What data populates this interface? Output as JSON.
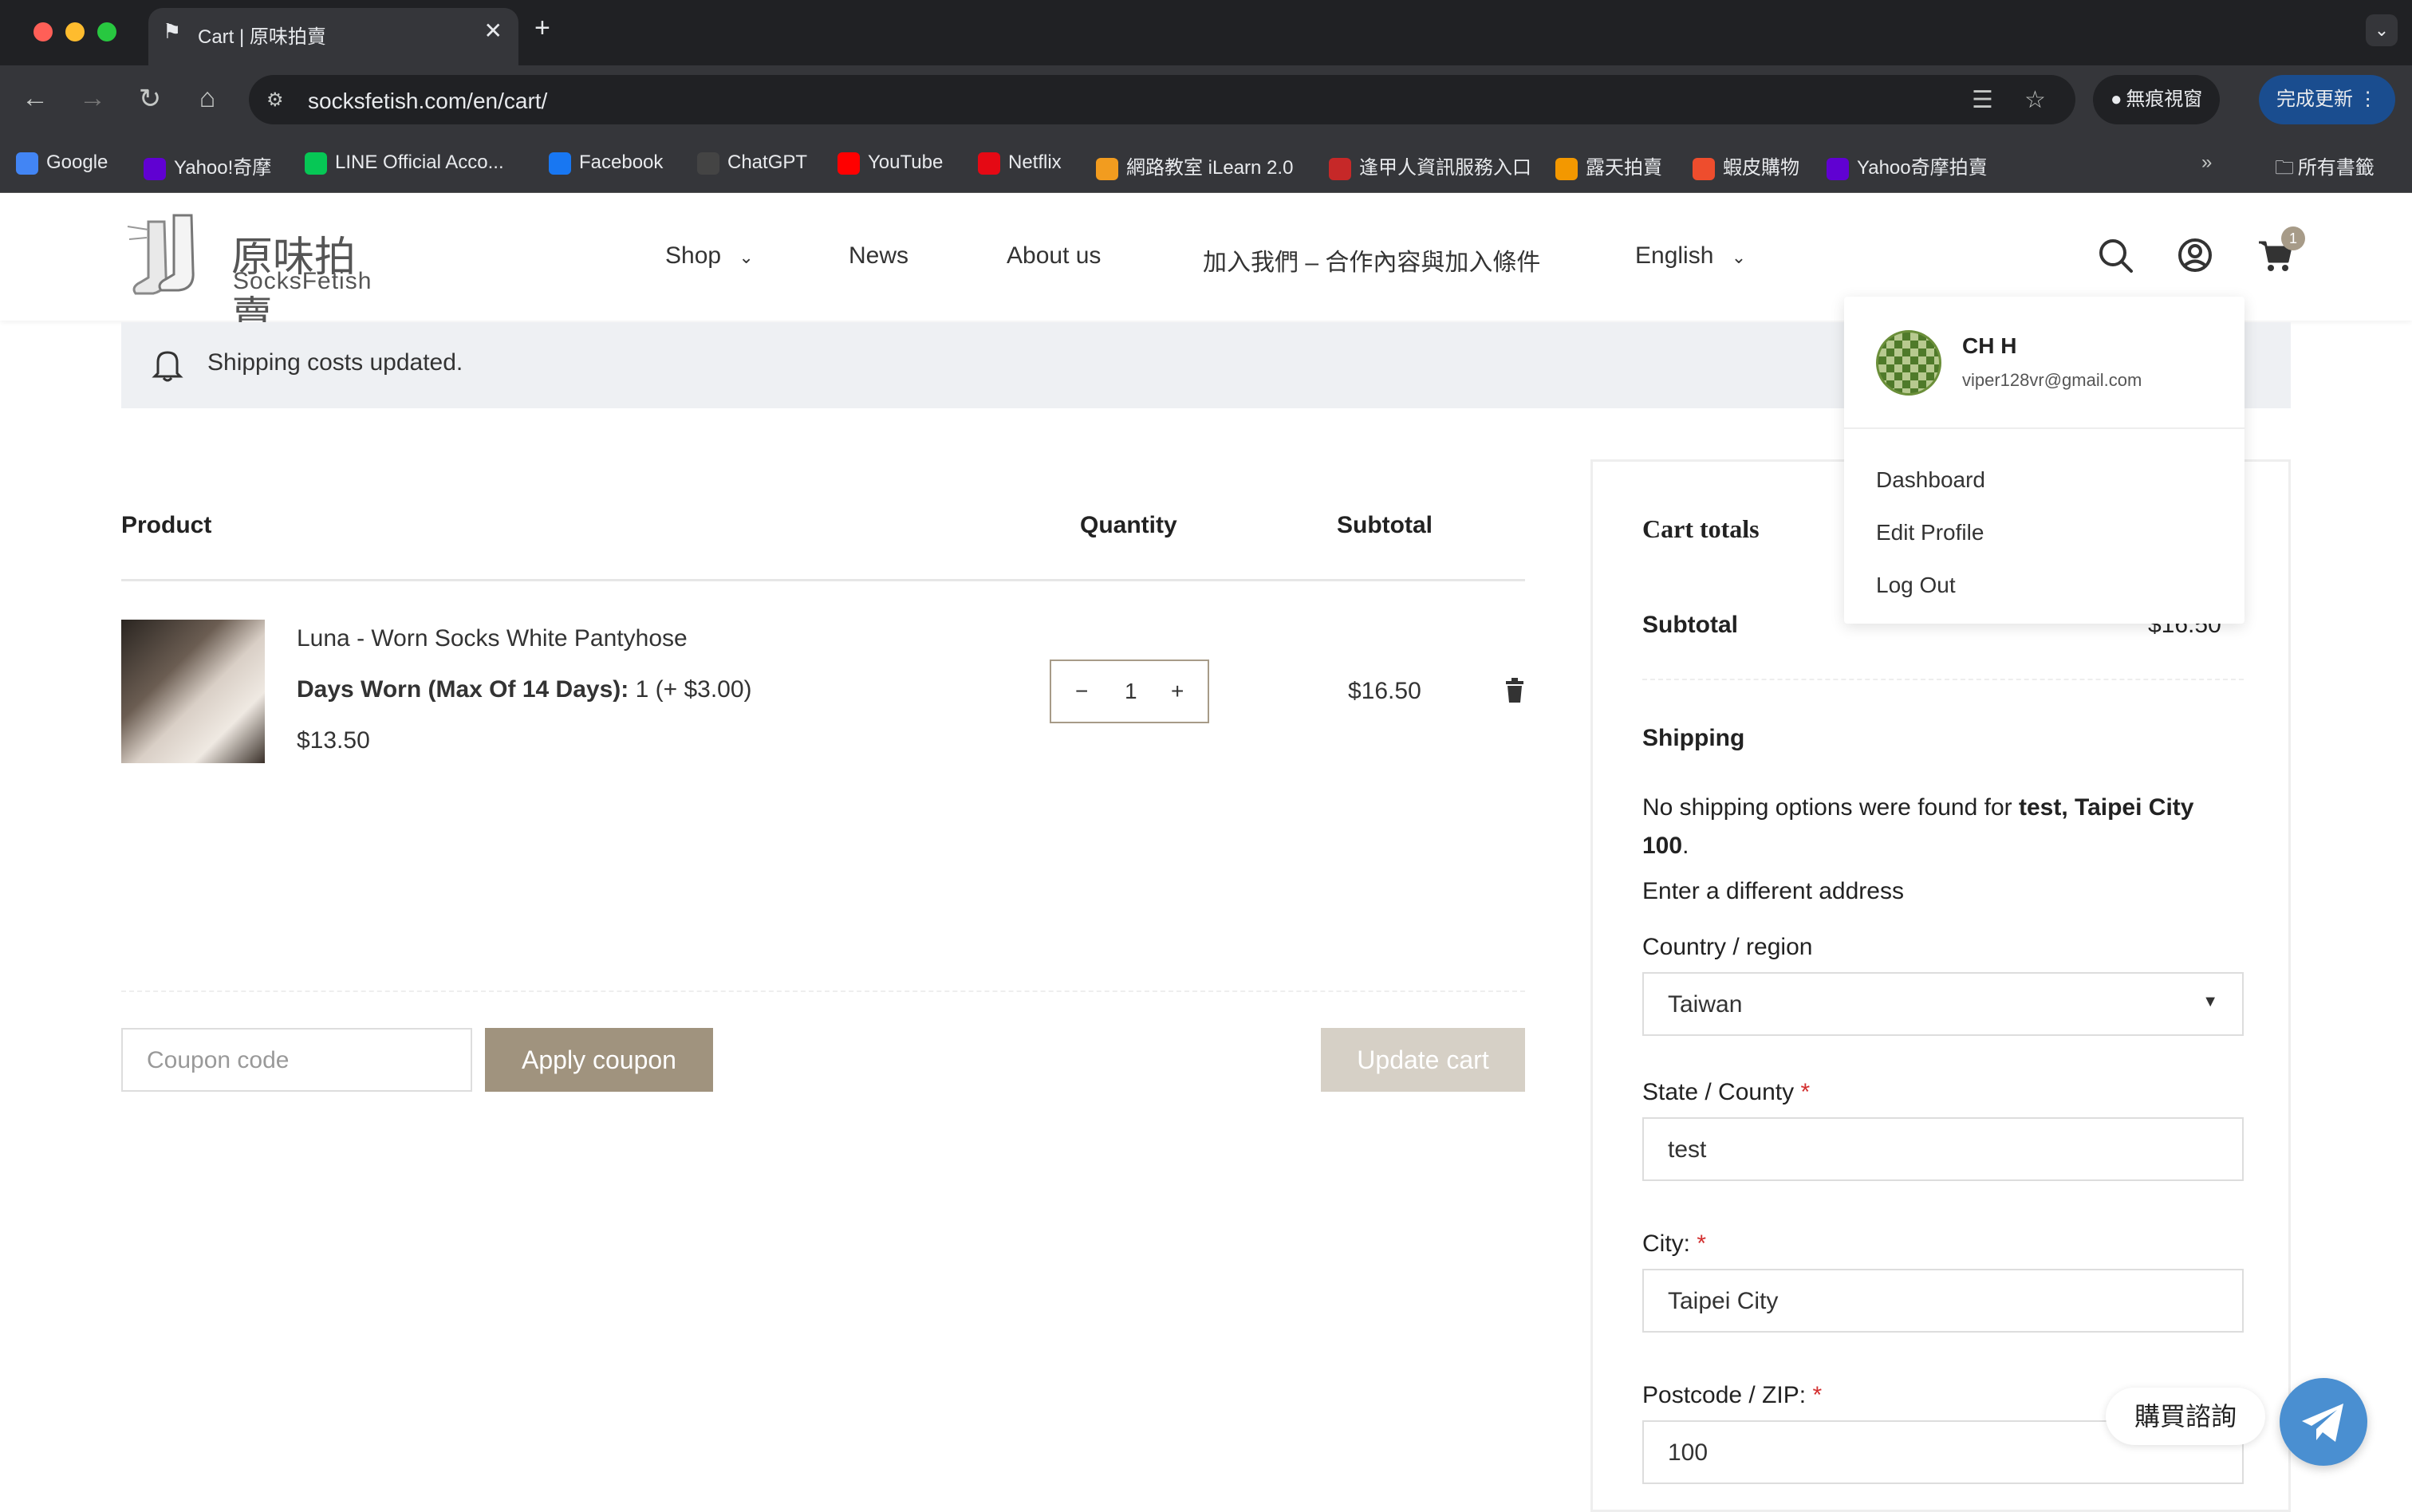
{
  "browser": {
    "tab_title": "Cart | 原味拍賣",
    "url": "socksfetish.com/en/cart/",
    "incognito_label": "無痕視窗",
    "update_label": "完成更新",
    "bookmarks": [
      {
        "label": "Google",
        "icon": "google-icon",
        "color": "#4285f4"
      },
      {
        "label": "Yahoo!奇摩",
        "icon": "yahoo-icon",
        "color": "#6001d2"
      },
      {
        "label": "LINE Official Acco...",
        "icon": "line-icon",
        "color": "#06c755"
      },
      {
        "label": "Facebook",
        "icon": "facebook-icon",
        "color": "#1877f2"
      },
      {
        "label": "ChatGPT",
        "icon": "chatgpt-icon",
        "color": "#444"
      },
      {
        "label": "YouTube",
        "icon": "youtube-icon",
        "color": "#ff0000"
      },
      {
        "label": "Netflix",
        "icon": "netflix-icon",
        "color": "#e50914"
      },
      {
        "label": "網路教室 iLearn 2.0",
        "icon": "ilearn-icon",
        "color": "#f29c1f"
      },
      {
        "label": "逢甲人資訊服務入口",
        "icon": "fcu-icon",
        "color": "#c62828"
      },
      {
        "label": "露天拍賣",
        "icon": "ruten-icon",
        "color": "#f39800"
      },
      {
        "label": "蝦皮購物",
        "icon": "shopee-icon",
        "color": "#ee4d2d"
      },
      {
        "label": "Yahoo奇摩拍賣",
        "icon": "yahoo-auction-icon",
        "color": "#6001d2"
      }
    ],
    "all_bookmarks_label": "所有書籤"
  },
  "site": {
    "logo_cn": "原味拍賣",
    "logo_en": "SocksFetish",
    "menu": {
      "shop": "Shop",
      "news": "News",
      "about": "About us",
      "join": "加入我們 – 合作內容與加入條件",
      "language": "English"
    },
    "cart_count": "1"
  },
  "notice": "Shipping costs updated.",
  "cart": {
    "headers": {
      "product": "Product",
      "quantity": "Quantity",
      "subtotal": "Subtotal"
    },
    "item": {
      "name": "Luna - Worn Socks White Pantyhose",
      "meta_label": "Days Worn (Max Of 14 Days):",
      "meta_value": "1 (+ $3.00)",
      "price": "$13.50",
      "quantity": "1",
      "minus": "−",
      "plus": "+",
      "subtotal": "$16.50"
    },
    "coupon_placeholder": "Coupon code",
    "apply_coupon": "Apply coupon",
    "update_cart": "Update cart"
  },
  "totals": {
    "title": "Cart totals",
    "subtotal_label": "Subtotal",
    "subtotal_value": "$16.50",
    "shipping_label": "Shipping",
    "no_shipping_prefix": "No shipping options were found for",
    "no_shipping_bold": "test, Taipei City 100",
    "no_shipping_suffix": ".",
    "different_address": "Enter a different address",
    "country_label": "Country / region",
    "country_value": "Taiwan",
    "state_label": "State / County",
    "state_value": "test",
    "city_label": "City:",
    "city_value": "Taipei City",
    "postcode_label": "Postcode / ZIP:",
    "postcode_value": "100",
    "required_mark": "*"
  },
  "account_menu": {
    "name": "CH H",
    "email": "viper128vr@gmail.com",
    "items": [
      "Dashboard",
      "Edit Profile",
      "Log Out"
    ]
  },
  "chat": {
    "label": "購買諮詢"
  },
  "colors": {
    "accent": "#a79b88",
    "button_dark": "#a0937e",
    "button_light": "#d6d0c6",
    "chat_blue": "#4a8fd1"
  }
}
